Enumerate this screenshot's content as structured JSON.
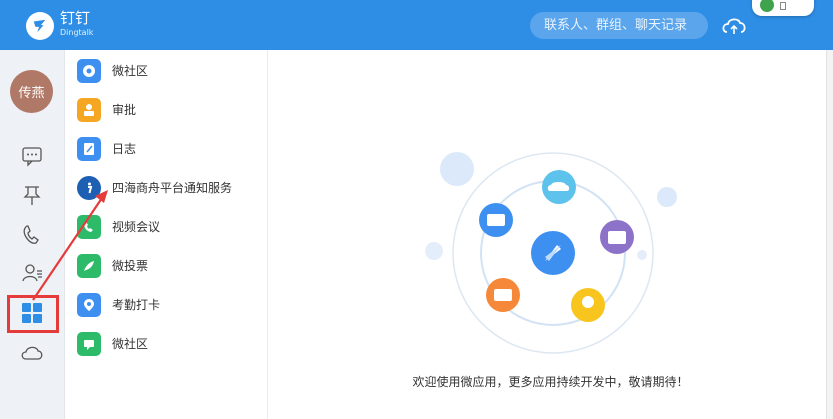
{
  "app": {
    "name": "钉钉",
    "subname": "Dingtalk"
  },
  "search": {
    "placeholder": "联系人、群组、聊天记录"
  },
  "user": {
    "avatar_text": "传燕"
  },
  "rail": {
    "items": [
      "chat-bubble-icon",
      "pin-icon",
      "phone-icon",
      "contacts-icon",
      "apps-grid-icon",
      "cloud-icon"
    ],
    "selected": "apps-grid-icon"
  },
  "apps": [
    {
      "label": "微社区",
      "icon": "community-icon",
      "color": "#3d8ff0"
    },
    {
      "label": "审批",
      "icon": "approval-icon",
      "color": "#f5a623"
    },
    {
      "label": "日志",
      "icon": "log-icon",
      "color": "#3d8ff0"
    },
    {
      "label": "四海商舟平台通知服务",
      "icon": "info-icon",
      "color": "#1d5fb3"
    },
    {
      "label": "视频会议",
      "icon": "video-meeting-icon",
      "color": "#2dbb6a"
    },
    {
      "label": "微投票",
      "icon": "vote-icon",
      "color": "#2dbb6a"
    },
    {
      "label": "考勤打卡",
      "icon": "attendance-icon",
      "color": "#3d8ff0"
    },
    {
      "label": "微社区",
      "icon": "community-icon",
      "color": "#2dbb6a"
    }
  ],
  "main": {
    "welcome": "欢迎使用微应用，更多应用持续开发中，敬请期待！"
  },
  "colors": {
    "topbar": "#2e8ee6",
    "highlight": "#e53b3b"
  }
}
